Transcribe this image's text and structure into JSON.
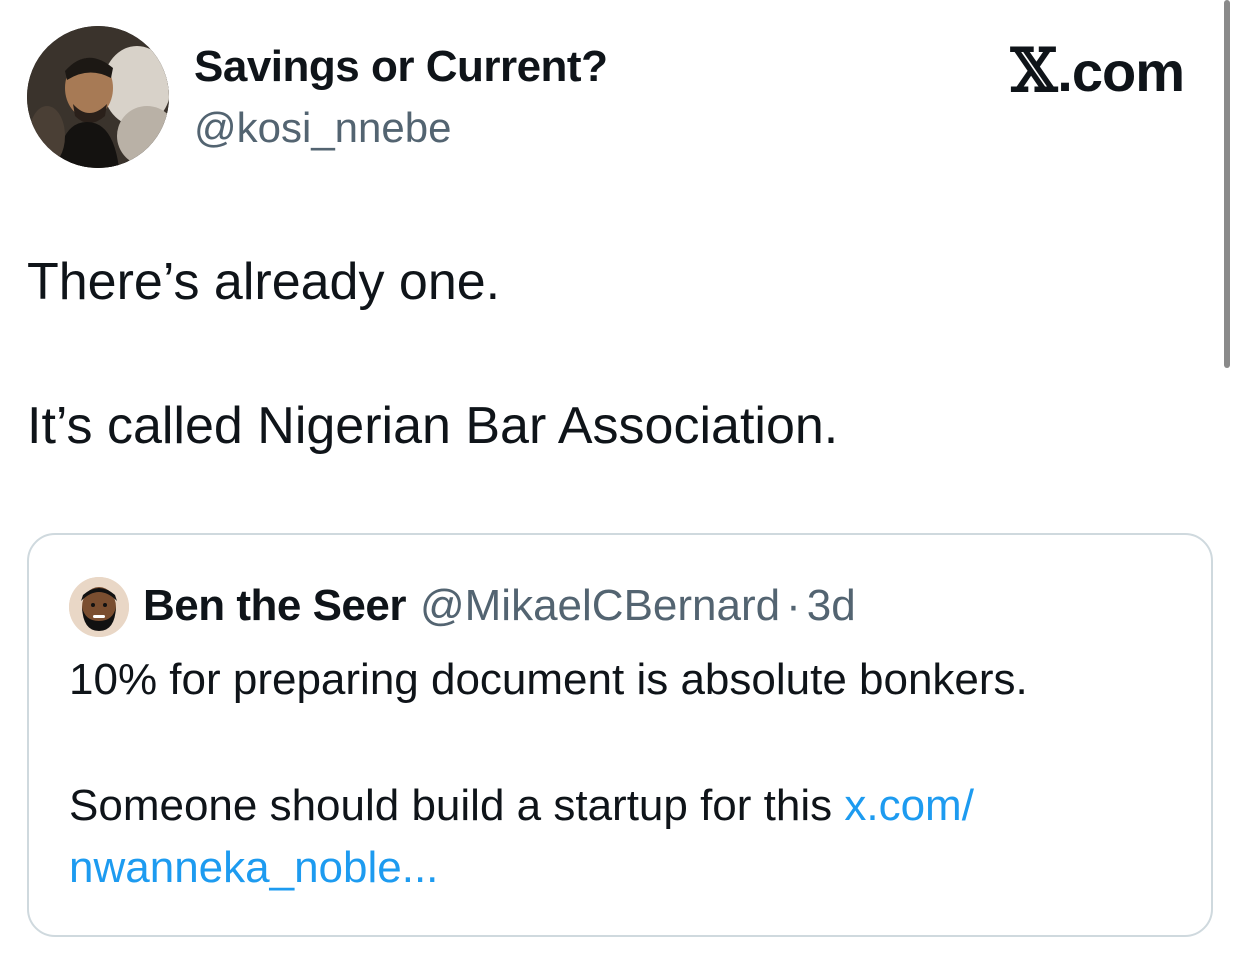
{
  "header": {
    "display_name": "Savings or Current?",
    "handle": "@kosi_nnebe",
    "brand_text": ".com",
    "brand_x": "𝕏"
  },
  "post": {
    "line1": "There’s already one.",
    "line2": "It’s called Nigerian Bar Association."
  },
  "quoted": {
    "display_name": "Ben the Seer",
    "handle": "@MikaelCBernard",
    "separator": "·",
    "time": "3d",
    "line1": "10% for preparing document is absolute bonkers.",
    "line2_text": "Someone should build a startup for this ",
    "link_part1": "x.com/",
    "link_part2": "nwanneka_noble..."
  },
  "colors": {
    "text": "#0f1419",
    "secondary": "#536471",
    "link": "#1d9bf0",
    "border": "#cfd9de"
  },
  "icons": {
    "avatar": "user-avatar-photo",
    "quoted_avatar": "bearded-man-avatar",
    "brand": "x-logo"
  }
}
